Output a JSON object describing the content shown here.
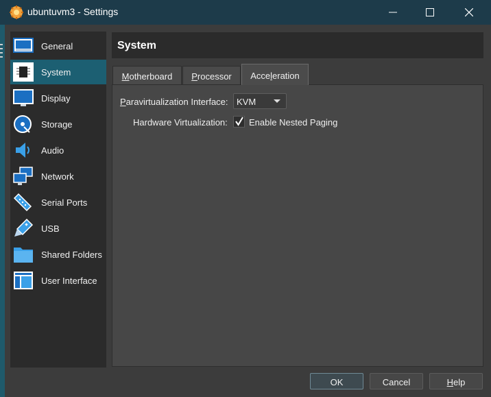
{
  "window": {
    "title": "ubuntuvm3 - Settings",
    "app_icon": "virtualbox-icon",
    "controls": [
      "minimize-icon",
      "maximize-icon",
      "close-icon"
    ]
  },
  "sidebar": {
    "items": [
      {
        "label": "General",
        "icon": "general-icon"
      },
      {
        "label": "System",
        "icon": "chip-icon",
        "selected": true
      },
      {
        "label": "Display",
        "icon": "monitor-icon"
      },
      {
        "label": "Storage",
        "icon": "disk-icon"
      },
      {
        "label": "Audio",
        "icon": "speaker-icon"
      },
      {
        "label": "Network",
        "icon": "network-icon"
      },
      {
        "label": "Serial Ports",
        "icon": "serial-port-icon"
      },
      {
        "label": "USB",
        "icon": "usb-icon"
      },
      {
        "label": "Shared Folders",
        "icon": "folder-icon"
      },
      {
        "label": "User Interface",
        "icon": "user-interface-icon"
      }
    ]
  },
  "page": {
    "title": "System",
    "tabs": [
      {
        "label": "Motherboard",
        "mnemonic": "M",
        "rest": "otherboard"
      },
      {
        "label": "Processor",
        "mnemonic": "P",
        "rest": "rocessor"
      },
      {
        "label": "Acceleration",
        "before": "Acce",
        "mnemonic": "l",
        "after": "eration",
        "active": true
      }
    ]
  },
  "acceleration": {
    "paravirt_label": {
      "mnemonic": "P",
      "rest": "aravirtualization Interface:"
    },
    "paravirt_value": "KVM",
    "hw_virt_label": "Hardware Virtualization:",
    "nested_paging": {
      "label": "Enable Nested Paging",
      "checked": true
    }
  },
  "buttons": {
    "ok": "OK",
    "cancel": "Cancel",
    "help": {
      "mnemonic": "H",
      "rest": "elp"
    }
  },
  "colors": {
    "titlebar": "#1d3b4a",
    "selection": "#1c5f72",
    "sidebar": "#2b2b2b",
    "panel": "#474747"
  }
}
